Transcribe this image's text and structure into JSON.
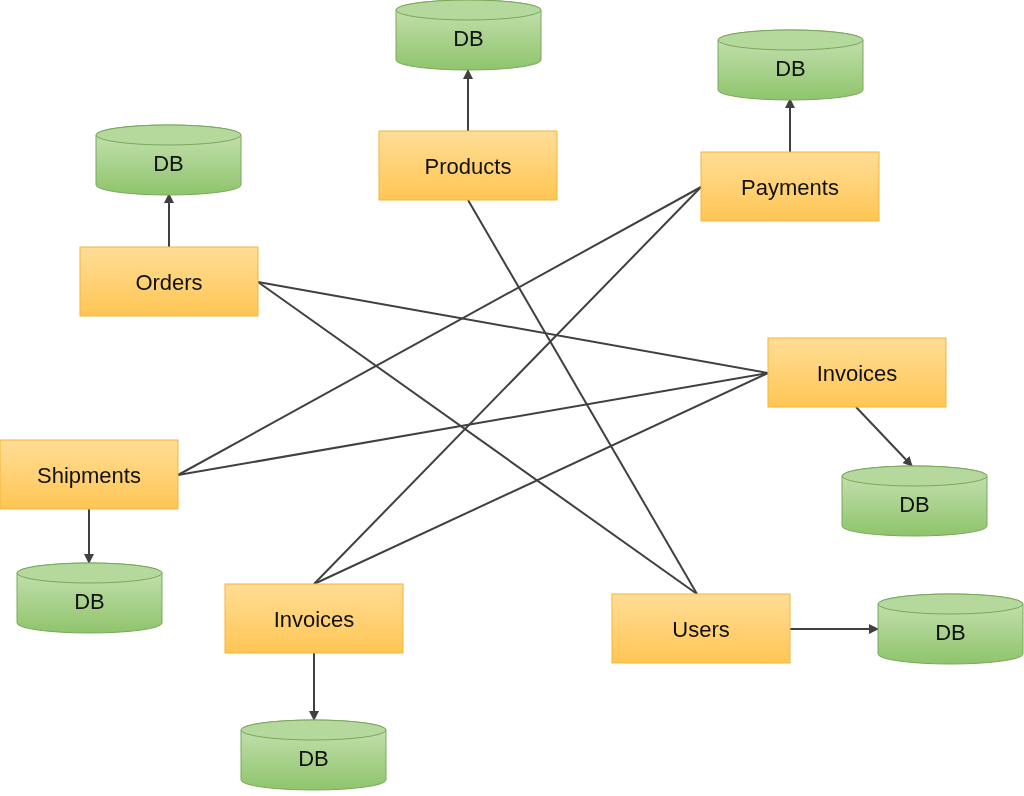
{
  "services": [
    {
      "label": "Products",
      "database": {
        "label": "DB"
      }
    },
    {
      "label": "Payments",
      "database": {
        "label": "DB"
      }
    },
    {
      "label": "Orders",
      "database": {
        "label": "DB"
      }
    },
    {
      "label": "Invoices",
      "database": {
        "label": "DB"
      }
    },
    {
      "label": "Shipments",
      "database": {
        "label": "DB"
      }
    },
    {
      "label": "Invoices",
      "database": {
        "label": "DB"
      }
    },
    {
      "label": "Users",
      "database": {
        "label": "DB"
      }
    }
  ]
}
